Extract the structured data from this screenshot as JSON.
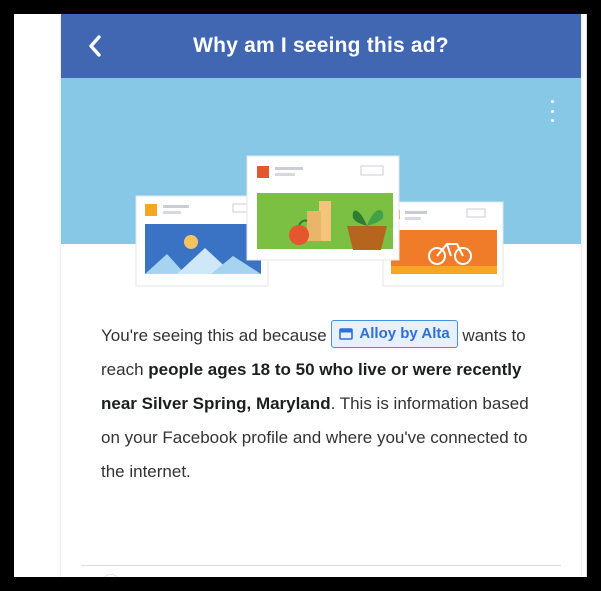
{
  "header": {
    "title": "Why am I seeing this ad?",
    "back_icon": "chevron-left-icon",
    "background_color": "#4267b2"
  },
  "hero": {
    "background_color": "#86c8e6",
    "menu_icon": "more-vertical-icon"
  },
  "explanation": {
    "intro": "You're seeing this ad because ",
    "advertiser": "Alloy by Alta",
    "advertiser_icon": "store-icon",
    "wants_to_reach": " wants to reach ",
    "audience": "people ages 18 to 50 who live or were recently near Silver Spring, Maryland",
    "outro": ". This is information based on your Facebook profile and where you've connected to the internet."
  }
}
